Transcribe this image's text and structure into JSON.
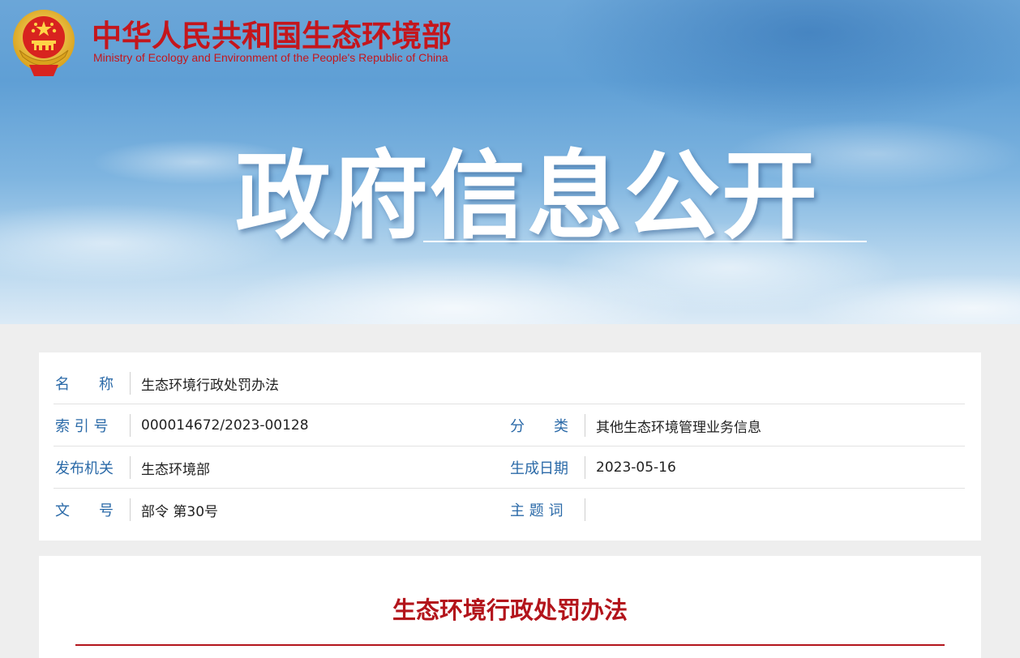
{
  "header": {
    "site_title_cn": "中华人民共和国生态环境部",
    "site_title_en": "Ministry of Ecology and Environment of the People's Republic of China",
    "emblem_icon": "national-emblem-icon"
  },
  "hero": {
    "title": "政府信息公开"
  },
  "metadata": {
    "name_label": "名　　称",
    "name_value": "生态环境行政处罚办法",
    "index_label": "索 引 号",
    "index_value": "000014672/2023-00128",
    "category_label": "分　　类",
    "category_value": "其他生态环境管理业务信息",
    "issuer_label": "发布机关",
    "issuer_value": "生态环境部",
    "date_label": "生成日期",
    "date_value": "2023-05-16",
    "docno_label": "文　　号",
    "docno_value": "部令 第30号",
    "keyword_label": "主 题 词",
    "keyword_value": ""
  },
  "document": {
    "title": "生态环境行政处罚办法"
  },
  "colors": {
    "brand_red": "#c4161c",
    "label_blue": "#2b6aa8",
    "title_red": "#b3141b"
  }
}
